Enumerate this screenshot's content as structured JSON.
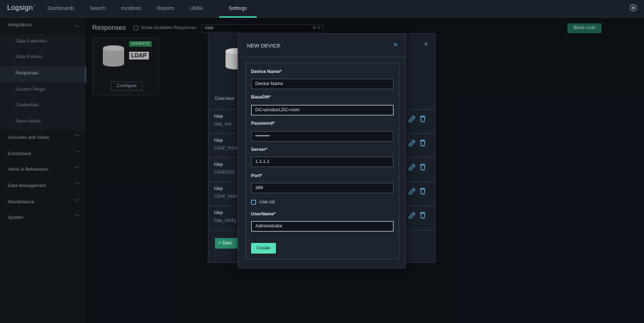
{
  "topbar": {
    "logo": "Logsign",
    "nav": [
      "Dashboards",
      "Search",
      "Incidents",
      "Reports",
      "UEBA",
      "Settings"
    ],
    "active_nav": "Settings"
  },
  "sidebar": {
    "integrations": {
      "label": "Integrations",
      "items": [
        "Data Collection",
        "Data Policies",
        "Responses",
        "Custom Plugin",
        "Credentials",
        "Demo Mode"
      ],
      "active": "Responses"
    },
    "sections": [
      "Accounts and Views",
      "Enrichment",
      "Alerts & Behaviours",
      "Data Management",
      "Maintenance",
      "System"
    ]
  },
  "main": {
    "title": "Responses",
    "show_available_label": "Show Available Responses",
    "search_value": "ldap",
    "block_lists_label": "Block Lists",
    "card": {
      "badge": "Installed (5)",
      "logo_text": "LDAP",
      "configure_label": "Configure"
    }
  },
  "background_panel": {
    "overview_tab": "Overview",
    "rows": [
      {
        "name": "ldap",
        "sub": "ldap_test"
      },
      {
        "name": "ldap",
        "sub": "LDAP_Produ"
      },
      {
        "name": "ldap",
        "sub": "LDAP2101"
      },
      {
        "name": "ldap",
        "sub": "LDAP_Intern"
      },
      {
        "name": "ldap",
        "sub": "ldap_config"
      }
    ],
    "add_device_label": "+ Devi"
  },
  "modal": {
    "title": "NEW DEVICE",
    "fields": {
      "device_name": {
        "label": "Device Name*",
        "value": "Device Name"
      },
      "basedn": {
        "label": "BaseDN*",
        "value": "DC=product,DC=com"
      },
      "password": {
        "label": "Password*",
        "value": "•••••••••"
      },
      "server": {
        "label": "Server*",
        "value": "1.1.1.1"
      },
      "port": {
        "label": "Port*",
        "value": "389"
      },
      "use_ssl_label": "Use ssl",
      "username": {
        "label": "UserName*",
        "value": "Administrator"
      }
    },
    "create_label": "Create"
  },
  "colors": {
    "accent": "#3bd4b0",
    "create_button": "#58e0b8",
    "block_lists": "#1f6f5c"
  }
}
